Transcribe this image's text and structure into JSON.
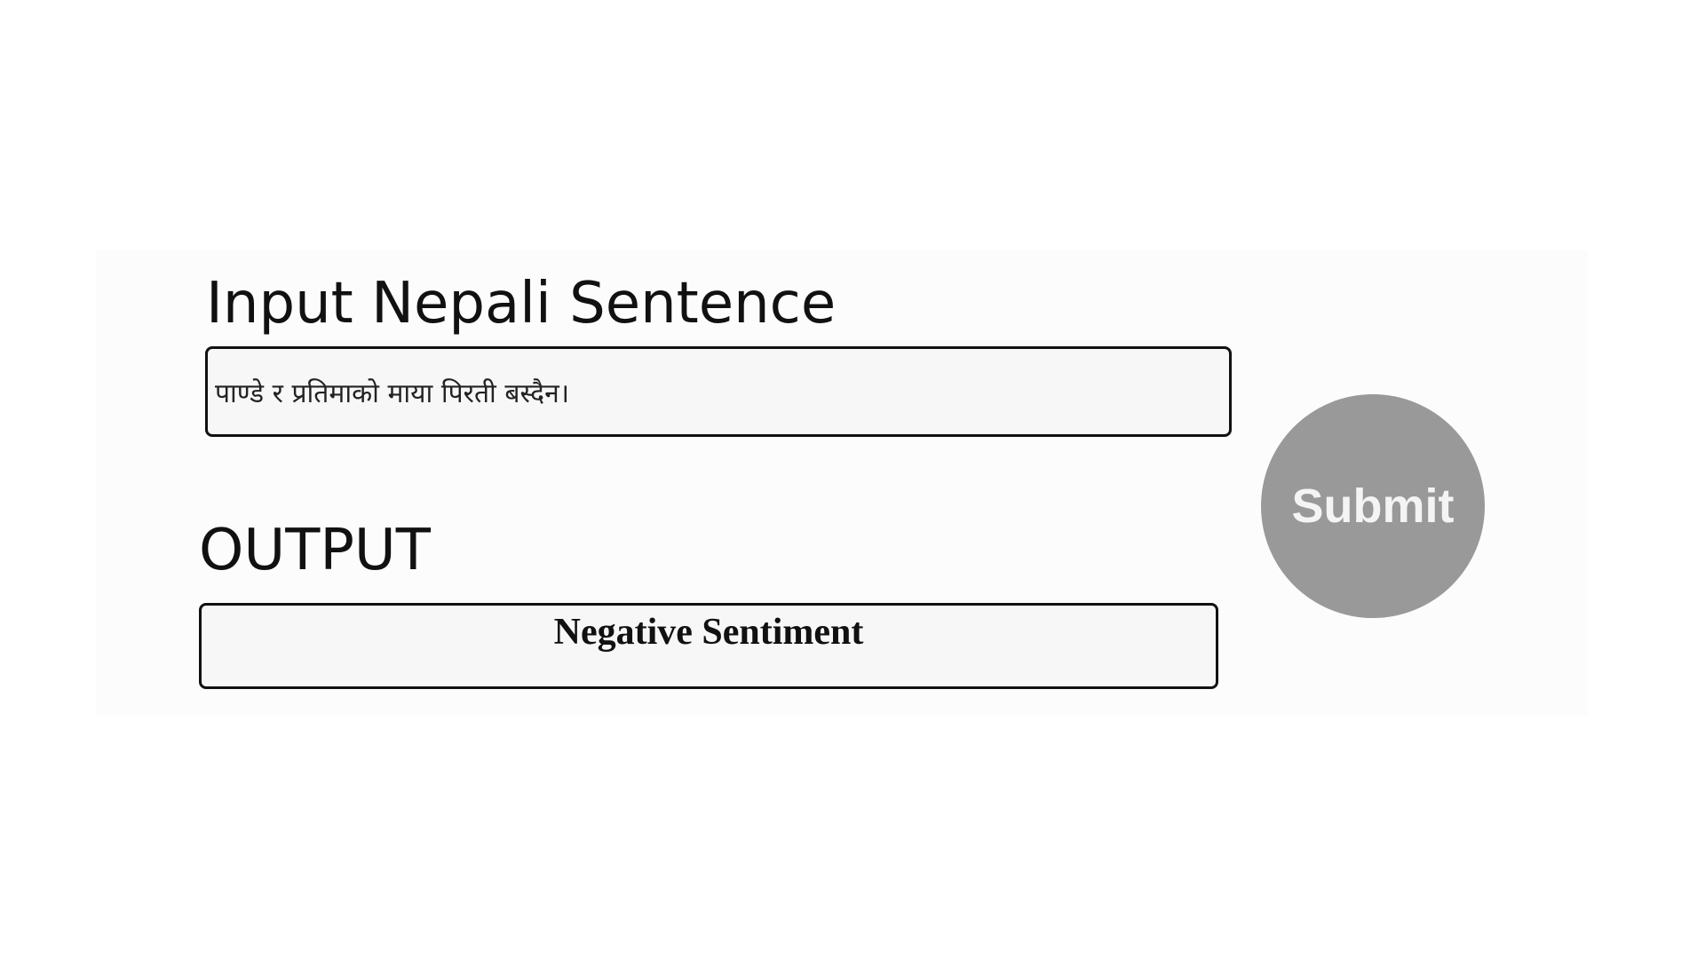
{
  "input": {
    "heading": "Input Nepali Sentence",
    "value": "पाण्डे र प्रतिमाको माया पिरती बस्दैन।"
  },
  "output": {
    "heading": "OUTPUT",
    "result": "Negative Sentiment"
  },
  "submit": {
    "label": "Submit"
  },
  "colors": {
    "submit_button_bg": "#999999",
    "field_bg": "#f7f7f7",
    "border": "#111111"
  }
}
